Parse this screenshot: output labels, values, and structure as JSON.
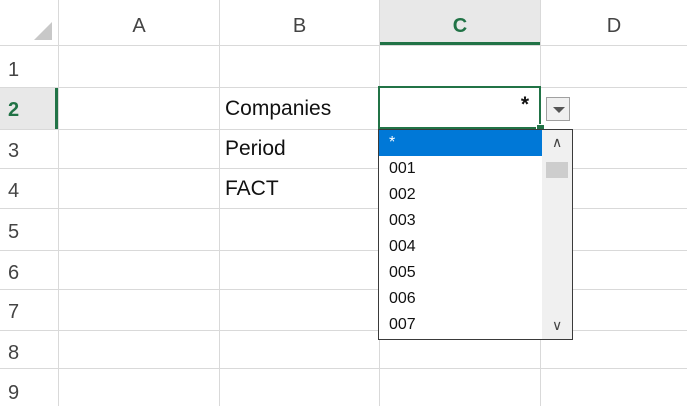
{
  "columns": [
    "A",
    "B",
    "C",
    "D"
  ],
  "active_column": "C",
  "rows": [
    "1",
    "2",
    "3",
    "4",
    "5",
    "6",
    "7",
    "8",
    "9"
  ],
  "active_row": "2",
  "cells": {
    "B2": "Companies",
    "B3": "Period",
    "B4": "FACT",
    "C2": "*"
  },
  "dropdown": {
    "selected": "*",
    "items": [
      "*",
      "001",
      "002",
      "003",
      "004",
      "005",
      "006",
      "007"
    ]
  },
  "colors": {
    "accent": "#217346",
    "selection": "#0078d7",
    "grid": "#d9d9d9"
  }
}
